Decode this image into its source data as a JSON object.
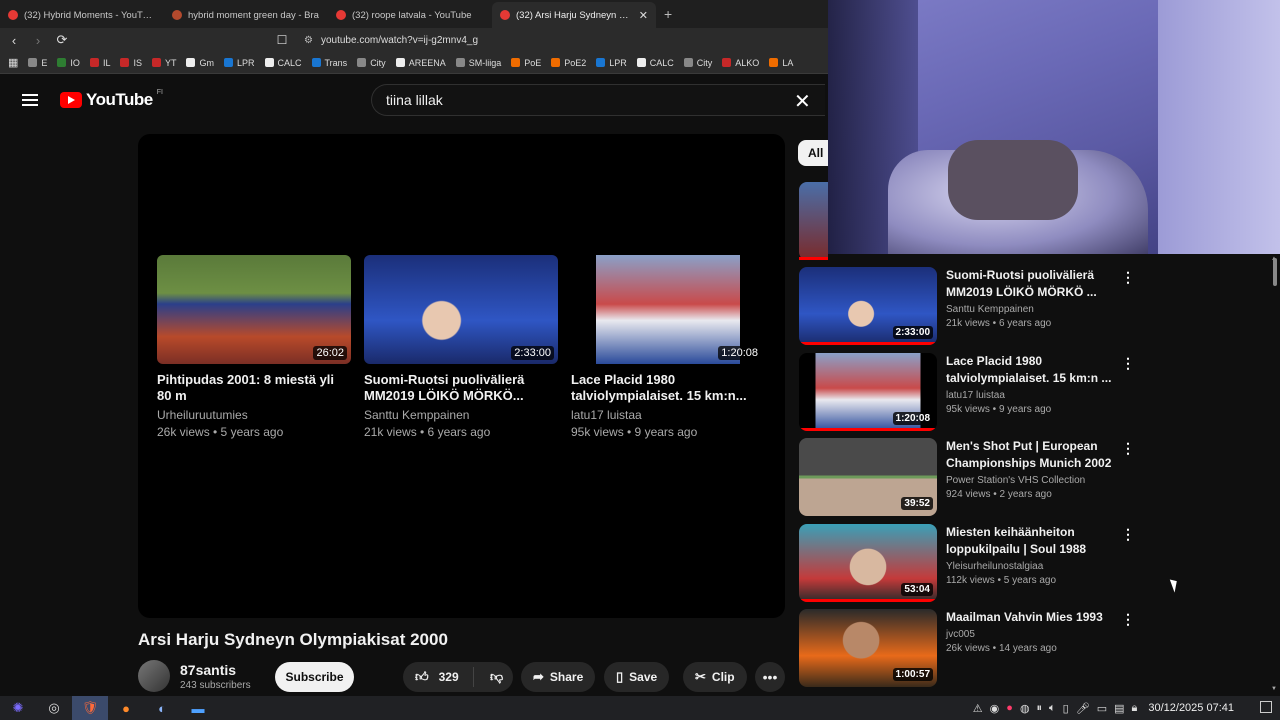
{
  "browser": {
    "tabs": [
      {
        "title": "(32) Hybrid Moments - YouTube",
        "active": false,
        "favicon": "youtube-favicon"
      },
      {
        "title": "hybrid moment green day - Bra",
        "active": false,
        "favicon": "brave-favicon"
      },
      {
        "title": "(32) roope latvala - YouTube",
        "active": false,
        "favicon": "youtube-favicon"
      },
      {
        "title": "(32) Arsi Harju Sydneyn Olym",
        "active": true,
        "favicon": "youtube-favicon"
      }
    ],
    "new_tab": "+",
    "close_tab": "✕",
    "url": "youtube.com/watch?v=ij-g2mnv4_g",
    "bookmarks": [
      {
        "label": "E"
      },
      {
        "label": "IO"
      },
      {
        "label": "IL"
      },
      {
        "label": "IS"
      },
      {
        "label": "YT"
      },
      {
        "label": "Gm"
      },
      {
        "label": "LPR"
      },
      {
        "label": "CALC"
      },
      {
        "label": "Trans"
      },
      {
        "label": "City"
      },
      {
        "label": "AREENA"
      },
      {
        "label": "SM-liiga"
      },
      {
        "label": "PoE"
      },
      {
        "label": "PoE2"
      },
      {
        "label": "LPR"
      },
      {
        "label": "CALC"
      },
      {
        "label": "City"
      },
      {
        "label": "ALKO"
      },
      {
        "label": "LA"
      }
    ]
  },
  "youtube": {
    "logo_text": "YouTube",
    "country_code": "FI",
    "search_query": "tiina lillak",
    "clear_symbol": "✕"
  },
  "player": {
    "endcards": [
      {
        "title": "Pihtipudas 2001: 8 miestä yli 80 m",
        "channel": "Urheiluruutumies",
        "meta": "26k views • 5 years ago",
        "duration": "26:02"
      },
      {
        "title": "Suomi-Ruotsi puolivälierä MM2019 LÖIKÖ MÖRKÖ...",
        "channel": "Santtu Kemppainen",
        "meta": "21k views • 6 years ago",
        "duration": "2:33:00"
      },
      {
        "title": "Lace Placid 1980 talviolympialaiset. 15 km:n...",
        "channel": "latu17 luistaa",
        "meta": "95k views • 9 years ago",
        "duration": "1:20:08"
      }
    ]
  },
  "video": {
    "title": "Arsi Harju Sydneyn Olympiakisat 2000",
    "channel": "87santis",
    "subscribers": "243 subscribers",
    "subscribe_label": "Subscribe",
    "likes": "329",
    "share_label": "Share",
    "save_label": "Save",
    "clip_label": "Clip"
  },
  "sidebar": {
    "chip_all": "All",
    "items": [
      {
        "title": "Suomi-Ruotsi puolivälierä MM2019 LÖIKÖ MÖRKÖ ...",
        "channel": "Santtu Kemppainen",
        "meta": "21k views • 6 years ago",
        "duration": "2:33:00"
      },
      {
        "title": "Lace Placid 1980 talviolympialaiset. 15 km:n ...",
        "channel": "latu17 luistaa",
        "meta": "95k views • 9 years ago",
        "duration": "1:20:08"
      },
      {
        "title": "Men's Shot Put | European Championships Munich 2002",
        "channel": "Power Station's VHS Collection",
        "meta": "924 views • 2 years ago",
        "duration": "39:52"
      },
      {
        "title": "Miesten keihäänheiton loppukilpailu | Soul 1988",
        "channel": "Yleisurheilunostalgiaa",
        "meta": "112k views • 5 years ago",
        "duration": "53:04"
      },
      {
        "title": "Maailman Vahvin Mies 1993",
        "channel": "jvc005",
        "meta": "26k views • 14 years ago",
        "duration": "1:00:57"
      }
    ]
  },
  "taskbar": {
    "clock": "30/12/2025 07:41"
  }
}
